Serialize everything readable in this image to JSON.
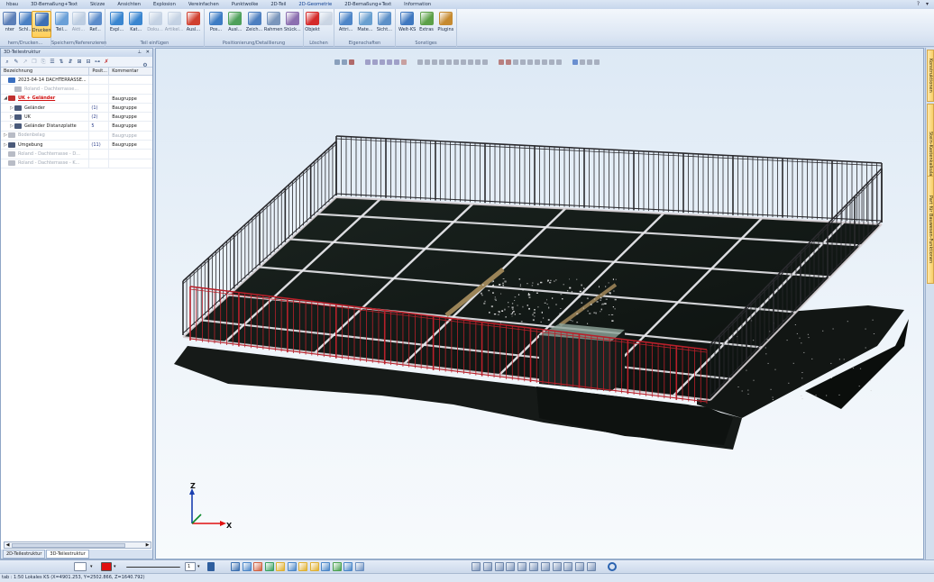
{
  "menu": {
    "items": [
      "hbau",
      "3D-Bemaßung+Text",
      "Skizze",
      "Ansichten",
      "Explosion",
      "Vereinfachen",
      "Punktwolke",
      "2D-Teil",
      "2D-Geometrie",
      "2D-Bemaßung+Text",
      "Information"
    ],
    "active_index": 8
  },
  "ribbon": {
    "groups": [
      {
        "label": "hern/Drucken...",
        "buttons": [
          {
            "label": "nter",
            "color": "#5b7fb8"
          },
          {
            "label": "Schl...",
            "color": "#4a80c4"
          },
          {
            "label": "Drucken",
            "color": "#3d6fb5",
            "active": true
          }
        ]
      },
      {
        "label": "Speichern/Referenzieren",
        "buttons": [
          {
            "label": "Teil...",
            "color": "#6aa0d8"
          },
          {
            "label": "Akti...",
            "color": "#8aa6c8",
            "disabled": true
          },
          {
            "label": "Ref...",
            "color": "#5c8ccb"
          }
        ]
      },
      {
        "label": "Teil einfügen",
        "buttons": [
          {
            "label": "Expl...",
            "color": "#3a86d0"
          },
          {
            "label": "Kat...",
            "color": "#3a86d0"
          },
          {
            "label": "Doku...",
            "color": "#9ab0cc",
            "disabled": true
          },
          {
            "label": "Artikel...",
            "color": "#9ab0cc",
            "disabled": true
          },
          {
            "label": "Ausl...",
            "color": "#d04030"
          }
        ]
      },
      {
        "label": "Positionierung/Detaillierung",
        "buttons": [
          {
            "label": "Pos...",
            "color": "#3d7cc4"
          },
          {
            "label": "Ausl...",
            "color": "#4ea05a"
          },
          {
            "label": "Zeich...",
            "color": "#4d7fc0"
          },
          {
            "label": "Rahmen",
            "color": "#7a96bc"
          },
          {
            "label": "Stück...",
            "color": "#8c6fb0"
          }
        ]
      },
      {
        "label": "Löschen",
        "buttons": [
          {
            "label": "Objekt",
            "color": "#d42a2a"
          },
          {
            "label": "",
            "color": "#a9b8cc",
            "disabled": true
          }
        ]
      },
      {
        "label": "Eigenschaften",
        "buttons": [
          {
            "label": "Attri...",
            "color": "#4f86c8"
          },
          {
            "label": "Mate...",
            "color": "#6aa0d0"
          },
          {
            "label": "Sicht...",
            "color": "#5c90c8"
          }
        ]
      },
      {
        "label": "Sonstiges",
        "buttons": [
          {
            "label": "Welt-KS",
            "color": "#3f78c0"
          },
          {
            "label": "Extras",
            "color": "#5ca048"
          },
          {
            "label": "Plugins",
            "color": "#c68a30"
          }
        ]
      }
    ]
  },
  "panel": {
    "title": "3D-Teilestruktur",
    "columns": [
      "Bezeichnung",
      "Posit...",
      "Kommentar"
    ],
    "rows": [
      {
        "indent": 0,
        "expander": "",
        "name": "2023-04-14 DACHTERRASSE...",
        "pos": "",
        "comment": "",
        "style": "root"
      },
      {
        "indent": 1,
        "expander": "",
        "name": "Roland - Dachterrasse...",
        "pos": "",
        "comment": "",
        "style": "grey"
      },
      {
        "indent": 0,
        "expander": "◢",
        "name": "UK + Geländer",
        "pos": "",
        "comment": "Baugruppe",
        "style": "red"
      },
      {
        "indent": 1,
        "expander": "▷",
        "name": "Geländer",
        "pos": "(1)",
        "comment": "Baugruppe",
        "style": "normal"
      },
      {
        "indent": 1,
        "expander": "▷",
        "name": "UK",
        "pos": "(2)",
        "comment": "Baugruppe",
        "style": "normal"
      },
      {
        "indent": 1,
        "expander": "▷",
        "name": "Geländer Distanzplatte",
        "pos": "5",
        "comment": "Baugruppe",
        "style": "normal"
      },
      {
        "indent": 0,
        "expander": "▷",
        "name": "Bodenbelag",
        "pos": "",
        "comment": "Baugruppe",
        "style": "grey"
      },
      {
        "indent": 0,
        "expander": "▷",
        "name": "Umgebung",
        "pos": "(11)",
        "comment": "Baugruppe",
        "style": "normal"
      },
      {
        "indent": 0,
        "expander": "",
        "name": "Roland - Dachterrasse - D...",
        "pos": "",
        "comment": "",
        "style": "grey"
      },
      {
        "indent": 0,
        "expander": "",
        "name": "Roland - Dachterrasse - K...",
        "pos": "",
        "comment": "",
        "style": "grey"
      }
    ],
    "tabs": [
      "2D-Teilestruktur",
      "3D-Teilestruktur"
    ],
    "active_tab": 1
  },
  "viewport": {
    "axis_z": "Z",
    "axis_x": "X"
  },
  "right_dock": {
    "tabs": [
      "Konstruktionen",
      "Stein-Kastenkalkulation",
      "Part für Bauwesen-Funktionen"
    ]
  },
  "bottom_toolbar": {
    "scale_value": "1",
    "accent_color": "#e01010"
  },
  "status": {
    "text": "tab : 1:50   Lokales KS   (X=4901.253, Y=2502.866, Z=1640.792)"
  },
  "colors": {
    "rail_dark": "#2a2a2e",
    "rail_red": "#b8202a",
    "deck": "#0f1411",
    "beam": "#e8e8ec",
    "wood": "#8a7048"
  }
}
